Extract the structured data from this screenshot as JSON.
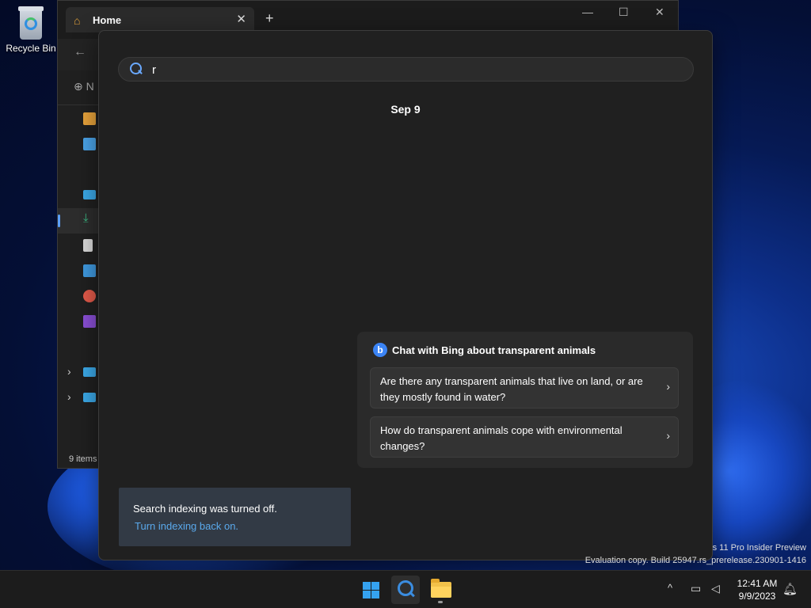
{
  "desktop": {
    "recycle_bin_label": "Recycle Bin"
  },
  "explorer": {
    "tab_title": "Home",
    "tab_close": "✕",
    "new_tab": "+",
    "minimize": "—",
    "maximize": "☐",
    "close": "✕",
    "back": "←",
    "new_label": "N",
    "status": "9 items",
    "sidebar_icons": [
      {
        "name": "home-icon",
        "color": "#e8a33b"
      },
      {
        "name": "gallery-icon",
        "color": "#4aa3e8"
      },
      {
        "name": "desktop-icon",
        "color": "#3ba9e8"
      },
      {
        "name": "downloads-icon",
        "color": "#3bbd86"
      },
      {
        "name": "documents-icon",
        "color": "#d9d9d9"
      },
      {
        "name": "pictures-icon",
        "color": "#3f9ae0"
      },
      {
        "name": "music-icon",
        "color": "#e35a4a"
      },
      {
        "name": "videos-icon",
        "color": "#8a4fd6"
      },
      {
        "name": "this-pc-icon",
        "color": "#3ba9e8"
      },
      {
        "name": "network-icon",
        "color": "#3ba9e8"
      }
    ]
  },
  "search": {
    "query": "r",
    "date_heading": "Sep 9",
    "bing": {
      "logo": "b",
      "title": "Chat with Bing about transparent animals",
      "questions": [
        "Are there any transparent animals that live on land, or are they mostly found in water?",
        "How do transparent animals cope with environmental changes?"
      ],
      "chevron": "›"
    },
    "indexing": {
      "message": "Search indexing was turned off.",
      "link": "Turn indexing back on."
    }
  },
  "watermark": {
    "line1": "s 11 Pro Insider Preview",
    "line2": "Evaluation copy. Build 25947.rs_prerelease.230901-1416"
  },
  "taskbar": {
    "tray_chevron": "^",
    "time": "12:41 AM",
    "date": "9/9/2023"
  }
}
